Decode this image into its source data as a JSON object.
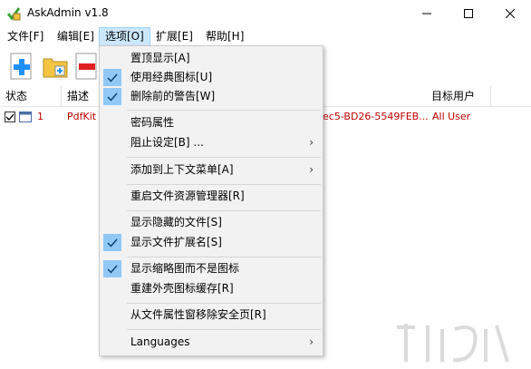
{
  "window": {
    "title": "AskAdmin v1.8"
  },
  "menubar": {
    "items": [
      {
        "label": "文件[F]"
      },
      {
        "label": "编辑[E]"
      },
      {
        "label": "选项[O]"
      },
      {
        "label": "扩展[E]"
      },
      {
        "label": "帮助[H]"
      }
    ]
  },
  "table": {
    "headers": {
      "status": "状态",
      "desc": "描述",
      "target_user": "目标用户"
    },
    "row": {
      "num": "1",
      "desc": "PdfKit",
      "guid": "ec5-BD26-5549FEB...",
      "user": "All User"
    }
  },
  "options_menu": {
    "items": [
      {
        "label": "置顶显示[A]",
        "checked": false
      },
      {
        "label": "使用经典图标[U]",
        "checked": true
      },
      {
        "label": "删除前的警告[W]",
        "checked": true
      },
      {
        "label": "密码属性",
        "checked": false
      },
      {
        "label": "阻止设定[B] ...",
        "checked": false,
        "submenu": true
      },
      {
        "label": "添加到上下文菜单[A]",
        "checked": false,
        "submenu": true
      },
      {
        "label": "重启文件资源管理器[R]",
        "checked": false
      },
      {
        "label": "显示隐藏的文件[S]",
        "checked": false
      },
      {
        "label": "显示文件扩展名[S]",
        "checked": true
      },
      {
        "label": "显示缩略图而不是图标",
        "checked": true
      },
      {
        "label": "重建外壳图标缓存[R]",
        "checked": false
      },
      {
        "label": "从文件属性窗移除安全页[R]",
        "checked": false
      },
      {
        "label": "Languages",
        "checked": false,
        "submenu": true
      }
    ],
    "submenu_arrow": "›"
  },
  "colors": {
    "check_bg": "#90c8f6",
    "accent": "#0078d7",
    "row_text": "#c00000"
  }
}
